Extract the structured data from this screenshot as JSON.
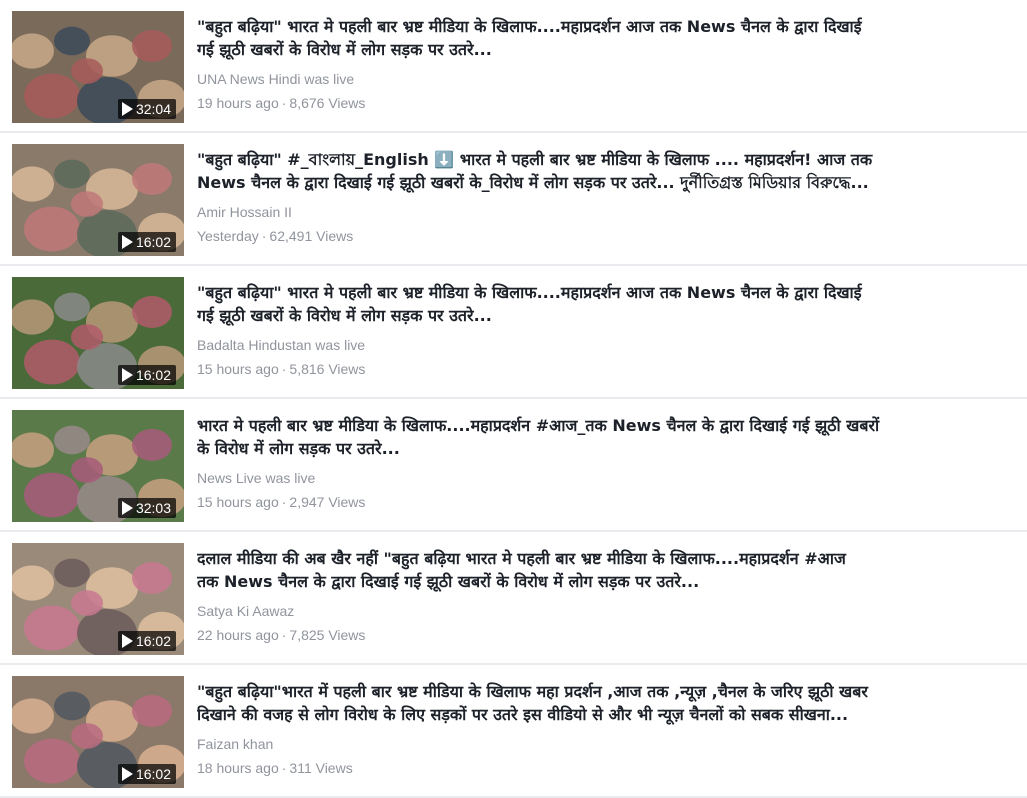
{
  "videos": [
    {
      "title_lines": [
        "\"बहुत बढ़िया\" भारत मे पहली बार भ्रष्ट मीडिया के खिलाफ....महाप्रदर्शन आज तक News चैनल के द्वारा दिखाई",
        "गई झूठी खबरों के विरोध में लोग सड़क पर उतरे..."
      ],
      "channel": "UNA News Hindi was live",
      "time": "19 hours ago",
      "views": "8,676 Views",
      "duration": "32:04",
      "thumb_colors": [
        "#7a6a5a",
        "#c9a888",
        "#3c4a5a",
        "#a85a5a"
      ]
    },
    {
      "title_lines": [
        "\"बहुत बढ़िया\" #_বাংলায়_English ⬇️ भारत मे पहली बार भ्रष्ट मीडिया के खिलाफ .... महाप्रदर्शन! आज तक",
        "News चैनल के द्वारा दिखाई गई झूठी खबरों के_विरोध में लोग सड़क पर उतरे... দুর্নীতিগ্রস্ত মিডিয়ার বিরুদ্ধে..."
      ],
      "channel": "Amir Hossain II",
      "time": "Yesterday",
      "views": "62,491 Views",
      "duration": "16:02",
      "thumb_colors": [
        "#8a7a6a",
        "#d8b898",
        "#5a6a5a",
        "#c07878"
      ]
    },
    {
      "title_lines": [
        "\"बहुत बढ़िया\" भारत मे पहली बार भ्रष्ट मीडिया के खिलाफ....महाप्रदर्शन आज तक News चैनल के द्वारा दिखाई",
        "गई झूठी खबरों के विरोध में लोग सड़क पर उतरे..."
      ],
      "channel": "Badalta Hindustan was live",
      "time": "15 hours ago",
      "views": "5,816 Views",
      "duration": "16:02",
      "thumb_colors": [
        "#4a6a3a",
        "#b89878",
        "#8a8a8a",
        "#b05a6a"
      ]
    },
    {
      "title_lines": [
        "भारत मे पहली बार भ्रष्ट मीडिया के खिलाफ....महाप्रदर्शन #आज_तक News चैनल के द्वारा दिखाई गई झूठी खबरों",
        "के विरोध में लोग सड़क पर उतरे..."
      ],
      "channel": "News Live was live",
      "time": "15 hours ago",
      "views": "2,947 Views",
      "duration": "32:03",
      "thumb_colors": [
        "#5a7a4a",
        "#c8a080",
        "#9a8a8a",
        "#a85a7a"
      ]
    },
    {
      "title_lines": [
        "दलाल मीडिया की अब खैर नहीं \"बहुत बढ़िया भारत मे पहली बार भ्रष्ट मीडिया के खिलाफ....महाप्रदर्शन #आज",
        "तक News चैनल के द्वारा दिखाई गई झूठी खबरों के विरोध में लोग सड़क पर उतरे..."
      ],
      "channel": "Satya Ki Aawaz",
      "time": "22 hours ago",
      "views": "7,825 Views",
      "duration": "16:02",
      "thumb_colors": [
        "#9a8a7a",
        "#e0c0a0",
        "#6a5a5a",
        "#c87890"
      ]
    },
    {
      "title_lines": [
        "\"बहुत बढ़िया\"भारत में पहली बार भ्रष्ट मीडिया के खिलाफ महा प्रदर्शन ,आज तक ,न्यूज़ ,चैनल के जरिए झूठी खबर",
        "दिखाने की वजह से लोग विरोध के लिए सड़कों पर उतरे इस वीडियो से और भी न्यूज़ चैनलों को सबक सीखना..."
      ],
      "channel": "Faizan khan",
      "time": "18 hours ago",
      "views": "311 Views",
      "duration": "16:02",
      "thumb_colors": [
        "#8a7868",
        "#d8b090",
        "#505860",
        "#b86a80"
      ]
    }
  ],
  "separator": "·"
}
